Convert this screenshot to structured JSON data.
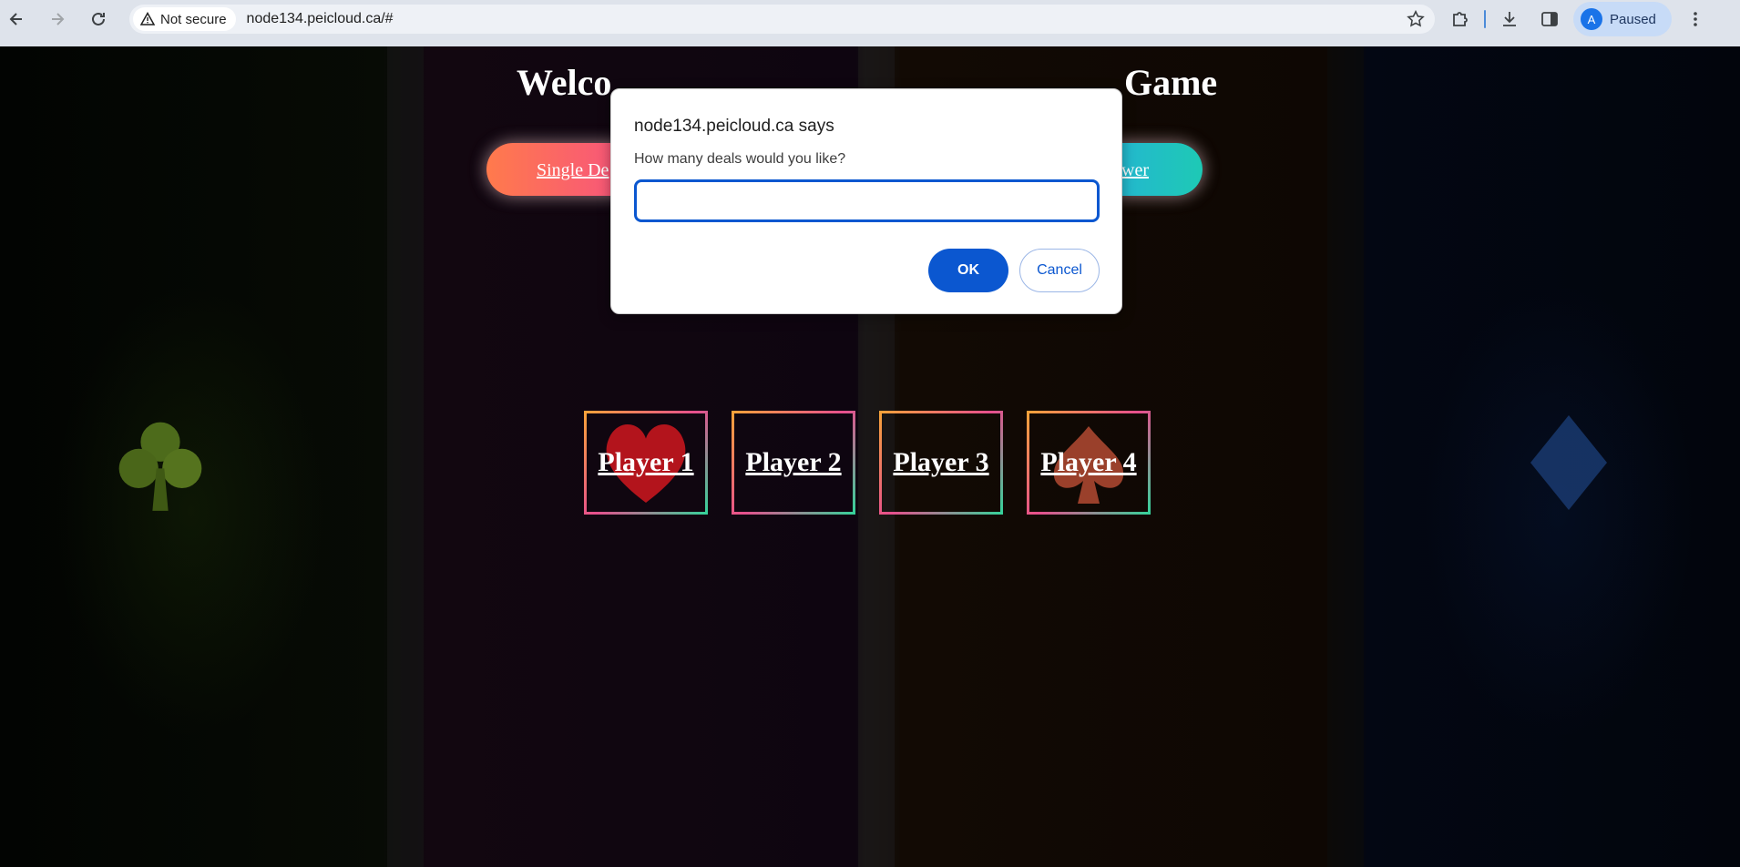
{
  "browser": {
    "security_label": "Not secure",
    "url": "node134.peicloud.ca/#",
    "profile_initial": "A",
    "profile_status": "Paused",
    "icons": [
      "back-icon",
      "forward-icon",
      "reload-icon",
      "warning-icon",
      "star-icon",
      "extensions-icon",
      "download-icon",
      "side-panel-icon",
      "more-icon"
    ]
  },
  "page": {
    "welcome_left": "Welco",
    "welcome_right": "Game",
    "menu_left": "Single De",
    "menu_right": "wer",
    "players": [
      "Player 1",
      "Player 2",
      "Player 3",
      "Player 4"
    ],
    "colors": {
      "menu_gradient": [
        "#ff7a4c",
        "#f54a8a",
        "#8a5cf0",
        "#25b3d6",
        "#1ec9b5"
      ]
    }
  },
  "dialog": {
    "title": "node134.peicloud.ca says",
    "message": "How many deals would you like?",
    "input_value": "",
    "ok_label": "OK",
    "cancel_label": "Cancel",
    "accent": "#0b57d0"
  }
}
